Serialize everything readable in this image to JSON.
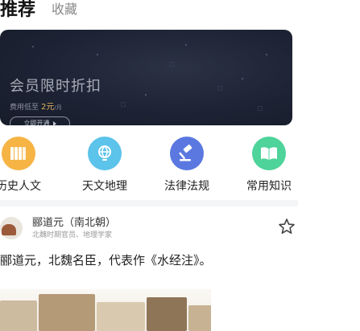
{
  "tabs": {
    "active": "推荐",
    "inactive": "收藏"
  },
  "banner": {
    "title": "会员限时折扣",
    "sub_prefix": "费用低至",
    "price": "2元",
    "unit": "/月",
    "button_label": "立即开通"
  },
  "categories": [
    {
      "label": "历史人文",
      "icon": "book-stack-icon",
      "color": "#f6b445"
    },
    {
      "label": "天文地理",
      "icon": "globe-icon",
      "color": "#5cc3ea"
    },
    {
      "label": "法律法规",
      "icon": "gavel-icon",
      "color": "#5a78e0"
    },
    {
      "label": "常用知识",
      "icon": "open-book-icon",
      "color": "#4ed39b"
    }
  ],
  "post": {
    "author_name": "郦道元（南北朝）",
    "author_desc": "北魏时期官员、地理学家",
    "text": "郦道元，北魏名臣，代表作《水经注》。"
  }
}
